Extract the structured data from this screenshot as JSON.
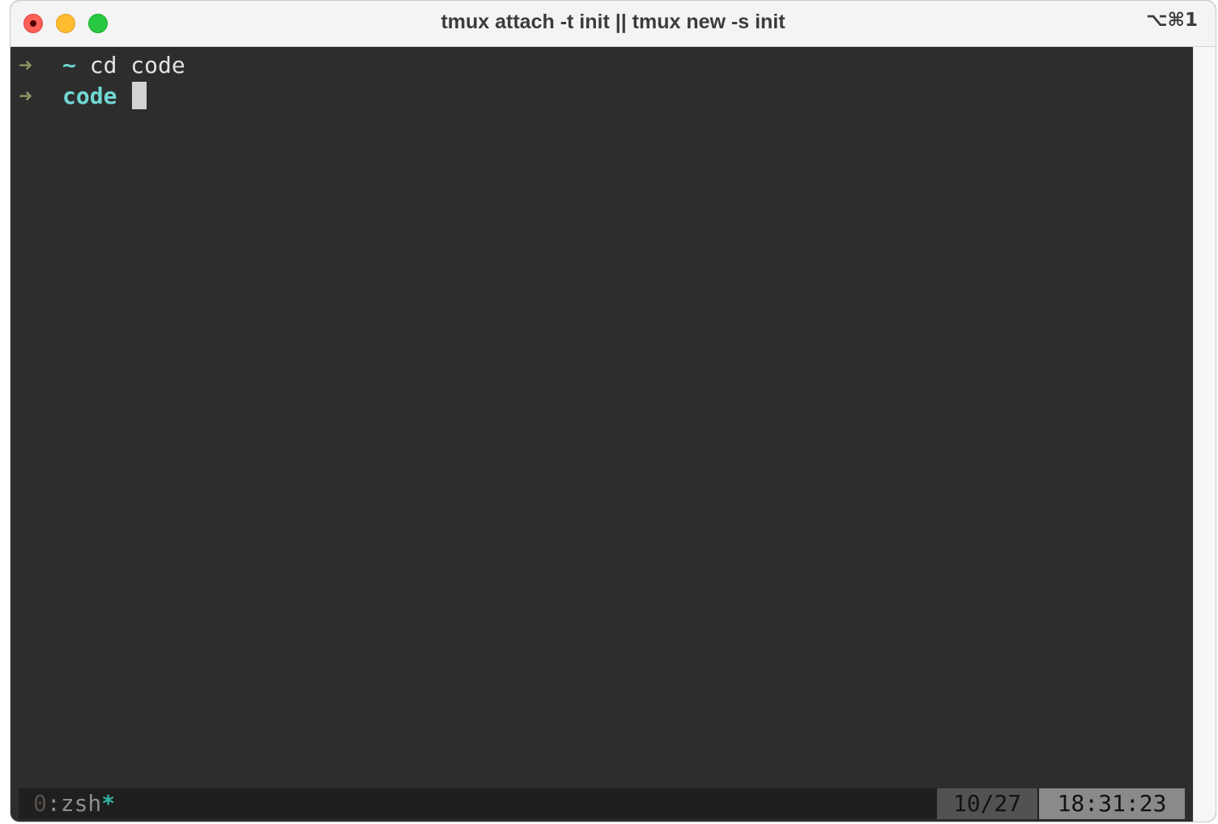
{
  "window": {
    "title": "tmux attach -t init || tmux new -s init",
    "shortcut": "⌥⌘1"
  },
  "terminal": {
    "lines": [
      {
        "arrow": "➜",
        "cwd": "~",
        "command": "cd code"
      },
      {
        "arrow": "➜",
        "cwd": "code",
        "command": ""
      }
    ]
  },
  "tmux_status": {
    "window_index": "0",
    "window_name": ":zsh",
    "window_flag": "*",
    "date": "10/27",
    "time": "18:31:23"
  },
  "colors": {
    "terminal_bg": "#2d2d2d",
    "prompt_arrow": "#8d9063",
    "cwd": "#6fd7d3",
    "text": "#e3e3e3",
    "status_bg": "#1f1f1f",
    "window_flag": "#2fb4a3"
  }
}
